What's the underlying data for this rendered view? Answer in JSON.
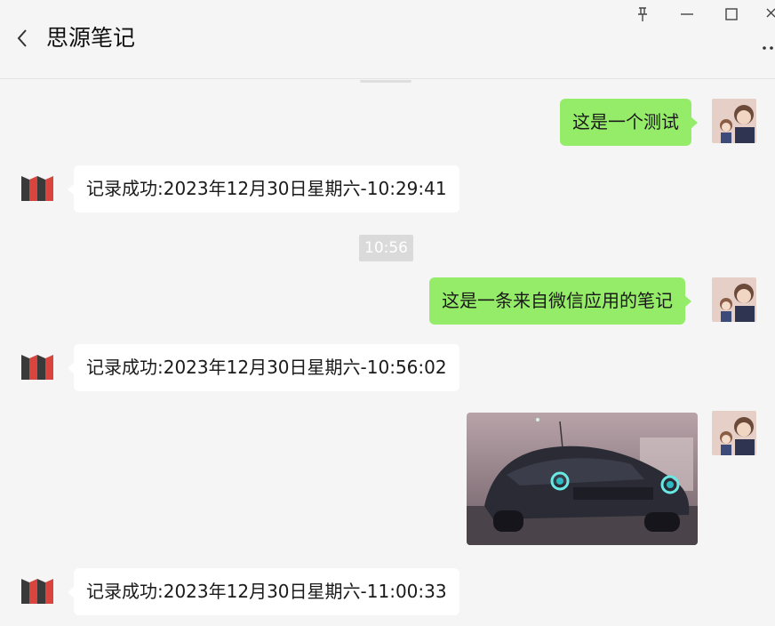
{
  "window": {
    "title": "思源笔记",
    "controls": [
      "pin-icon",
      "minimize-icon",
      "maximize-icon",
      "close-icon"
    ],
    "more_menu_icon": "more-dots-icon",
    "back_icon": "chevron-left-icon"
  },
  "colors": {
    "background": "#f5f5f5",
    "outgoing_bubble": "#95ec69",
    "incoming_bubble": "#ffffff",
    "timestamp_bg": "#dadada",
    "bot_logo_red": "#d9443c",
    "bot_logo_dark": "#3a3a3a"
  },
  "messages": [
    {
      "id": "m1",
      "direction": "out",
      "type": "text",
      "text": "这是一个测试"
    },
    {
      "id": "m2",
      "direction": "in",
      "type": "text",
      "text": "记录成功:2023年12月30日星期六-10:29:41"
    },
    {
      "id": "t1",
      "type": "timestamp",
      "text": "10:56"
    },
    {
      "id": "m3",
      "direction": "out",
      "type": "text",
      "text": "这是一条来自微信应用的笔记"
    },
    {
      "id": "m4",
      "direction": "in",
      "type": "text",
      "text": "记录成功:2023年12月30日星期六-10:56:02"
    },
    {
      "id": "m5",
      "direction": "out",
      "type": "image",
      "alt": "car-photo"
    },
    {
      "id": "m6",
      "direction": "in",
      "type": "text",
      "text": "记录成功:2023年12月30日星期六-11:00:33"
    }
  ]
}
